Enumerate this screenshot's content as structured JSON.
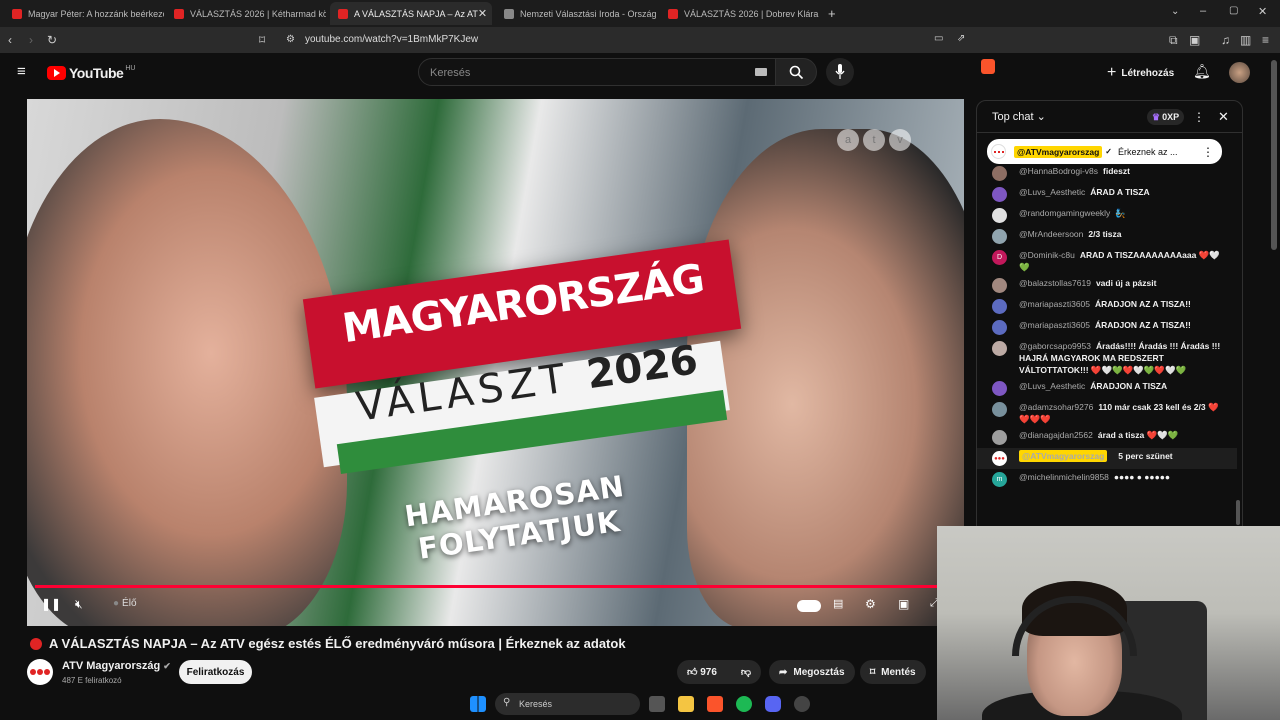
{
  "browser": {
    "tabs": [
      {
        "label": "Magyar Péter: A hozzánk beérkező ad",
        "active": false
      },
      {
        "label": "VÁLASZTÁS 2026 | Kétharmad közelé",
        "active": false
      },
      {
        "label": "A VÁLASZTÁS NAPJA – Az AT",
        "active": true
      },
      {
        "label": "Nemzeti Választási Iroda - Országgy",
        "active": false
      },
      {
        "label": "VÁLASZTÁS 2026 | Dobrev Klára nagy",
        "active": false
      }
    ],
    "new_tab": "+",
    "url": "youtube.com/watch?v=1BmMkP7KJew"
  },
  "youtube": {
    "logo_text": "YouTube",
    "country_code": "HU",
    "search_placeholder": "Keresés",
    "create_label": "Létrehozás",
    "create_plus": "+"
  },
  "video": {
    "overlay_line1": "MAGYARORSZÁG",
    "overlay_line2": "VÁLASZT",
    "overlay_year": "2026",
    "overlay_line3": "HAMAROSAN FOLYTATJUK",
    "watermark": [
      "a",
      "t",
      "v"
    ],
    "live_label": "Élő",
    "progress_fraction": 1.0
  },
  "meta": {
    "title": "A VÁLASZTÁS NAPJA – Az ATV egész estés ÉLŐ eredményváró műsora | Érkeznek az adatok",
    "channel_name": "ATV Magyarország",
    "subscribers": "487 E feliratkozó",
    "subscribe_label": "Feliratkozás",
    "likes": "976",
    "share_label": "Megosztás",
    "save_label": "Mentés"
  },
  "chat": {
    "title": "Top chat",
    "xp": "0XP",
    "pinned": {
      "author": "@ATVmagyarorszag",
      "text": "Érkeznek az ..."
    },
    "messages": [
      {
        "author": "@HannaBodrogi-v8s",
        "text": "fideszt",
        "color": "#8d6e63"
      },
      {
        "author": "@Luvs_Aesthetic",
        "text": "ÁRAD A TISZA",
        "color": "#7e57c2"
      },
      {
        "author": "@randomgamingweekly",
        "text": "🧞",
        "color": "#e0e0e0"
      },
      {
        "author": "@MrAndeersoon",
        "text": "2/3 tisza",
        "color": "#90a4ae"
      },
      {
        "author": "@Dominik-c8u",
        "text": "ARAD A TISZAAAAAAAAaaa ❤️🤍💚",
        "color": "#c2185b",
        "initial": "D"
      },
      {
        "author": "@balazstollas7619",
        "text": "vadi új a pázsit",
        "color": "#a1887f"
      },
      {
        "author": "@mariapaszti3605",
        "text": "ÁRADJON AZ A TISZA!!",
        "color": "#5c6bc0"
      },
      {
        "author": "@mariapaszti3605",
        "text": "ÁRADJON AZ A TISZA!!",
        "color": "#5c6bc0"
      },
      {
        "author": "@gaborcsapo9953",
        "text": "Áradás!!!! Áradás !!! Áradás !!! HAJRÁ MAGYAROK MA REDSZERT VÁLTOTTATOK!!! ❤️🤍💚❤️🤍💚❤️🤍💚",
        "color": "#bcaaa4"
      },
      {
        "author": "@Luvs_Aesthetic",
        "text": "ÁRADJON A TISZA",
        "color": "#7e57c2"
      },
      {
        "author": "@adamzsohar9276",
        "text": "110 már csak 23 kell és 2/3 ❤️❤️❤️❤️",
        "color": "#78909c"
      },
      {
        "author": "@dianagajdan2562",
        "text": "árad a tisza ❤️🤍💚",
        "color": "#9e9e9e"
      },
      {
        "author": "@ATVmagyarorszag",
        "text": "5 perc szünet",
        "color": "#ffffff",
        "channel": true
      },
      {
        "author": "@michelinmichelin9858",
        "text": "●●●● ● ●●●●●",
        "color": "#26a69a",
        "initial": "m"
      }
    ]
  },
  "taskbar": {
    "search_label": "Keresés"
  },
  "colors": {
    "accent_red": "#ff0033",
    "owner_badge": "#ffd600",
    "bg": "#0f0f0f"
  }
}
